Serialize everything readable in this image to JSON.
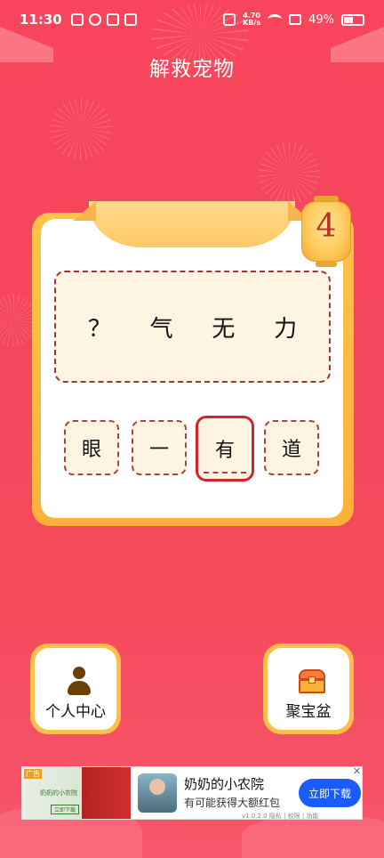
{
  "status_bar": {
    "time": "11:30",
    "speed_value": "4.70",
    "speed_unit": "KB/s",
    "battery": "49%"
  },
  "page": {
    "title": "解救宠物"
  },
  "level": {
    "number": "4"
  },
  "puzzle": {
    "answer_chars": [
      "？",
      "气",
      "无",
      "力"
    ],
    "choices": [
      "眼",
      "一",
      "有",
      "道"
    ],
    "selected_choice": "有"
  },
  "buttons": {
    "profile_label": "个人中心",
    "treasure_label": "聚宝盆"
  },
  "ad": {
    "badge": "广告",
    "thumb_title": "奶奶的小农院",
    "thumb_button": "立即下载",
    "title": "奶奶的小农院",
    "subtitle": "有可能获得大额红包",
    "cta": "立即下载",
    "close": "✕",
    "meta": "v1.0.2.0  隐私 | 权限 | 功能"
  },
  "colors": {
    "background": "#f5475c",
    "card_frame": "#ffb13a",
    "dashed_border": "#a8322e",
    "ad_button": "#1a5cff"
  }
}
